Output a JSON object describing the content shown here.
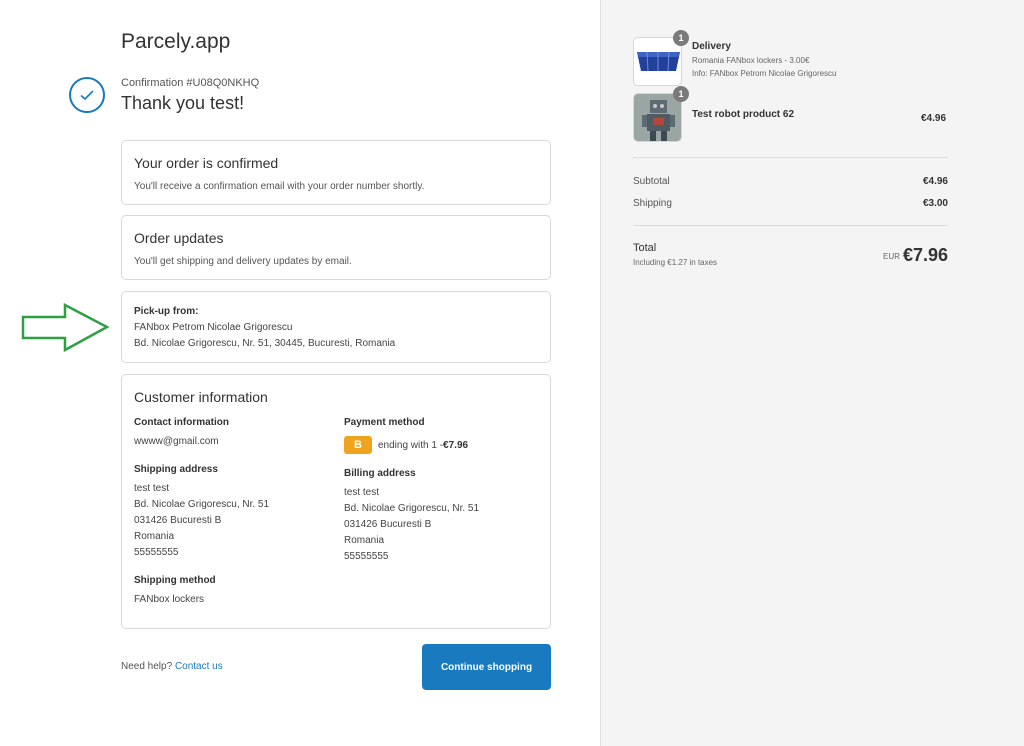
{
  "store": {
    "name": "Parcely.app"
  },
  "header": {
    "confirmation": "Confirmation #U08Q0NKHQ",
    "thank_you": "Thank you test!"
  },
  "confirmed": {
    "title": "Your order is confirmed",
    "subtitle": "You'll receive a confirmation email with your order number shortly."
  },
  "updates": {
    "title": "Order updates",
    "subtitle": "You'll get shipping and delivery updates by email."
  },
  "pickup": {
    "label": "Pick-up from:",
    "name": "FANbox Petrom Nicolae Grigorescu",
    "address": "Bd. Nicolae Grigorescu, Nr. 51, 30445, Bucuresti, Romania"
  },
  "customer": {
    "title": "Customer information",
    "contact": {
      "heading": "Contact information",
      "email": "wwww@gmail.com"
    },
    "shipping_address": {
      "heading": "Shipping address",
      "lines": [
        "test test",
        "Bd. Nicolae Grigorescu, Nr. 51",
        "031426 Bucuresti B",
        "Romania",
        "55555555"
      ]
    },
    "shipping_method": {
      "heading": "Shipping method",
      "value": "FANbox lockers"
    },
    "payment": {
      "heading": "Payment method",
      "badge": "B",
      "text": "ending with 1 - ",
      "amount": "€7.96"
    },
    "billing_address": {
      "heading": "Billing address",
      "lines": [
        "test test",
        "Bd. Nicolae Grigorescu, Nr. 51",
        "031426 Bucuresti B",
        "Romania",
        "55555555"
      ]
    }
  },
  "footer": {
    "help_text": "Need help?",
    "contact_link": "Contact us",
    "continue_label": "Continue shopping"
  },
  "summary": {
    "items": [
      {
        "qty": "1",
        "name": "Delivery",
        "line1": "Romania FANbox lockers - 3.00€",
        "line2": "Info: FANbox Petrom Nicolae Grigorescu",
        "price": ""
      },
      {
        "qty": "1",
        "name": "Test robot product 62",
        "price": "€4.96"
      }
    ],
    "subtotal_label": "Subtotal",
    "subtotal_value": "€4.96",
    "shipping_label": "Shipping",
    "shipping_value": "€3.00",
    "total_label": "Total",
    "taxes_note": "Including €1.27 in taxes",
    "currency": "EUR",
    "total_value": "€7.96"
  },
  "colors": {
    "accent": "#1a7ac0",
    "badge": "#f0a41e",
    "arrow": "#2ea043",
    "sidebar_bg": "#f4f4f4"
  }
}
